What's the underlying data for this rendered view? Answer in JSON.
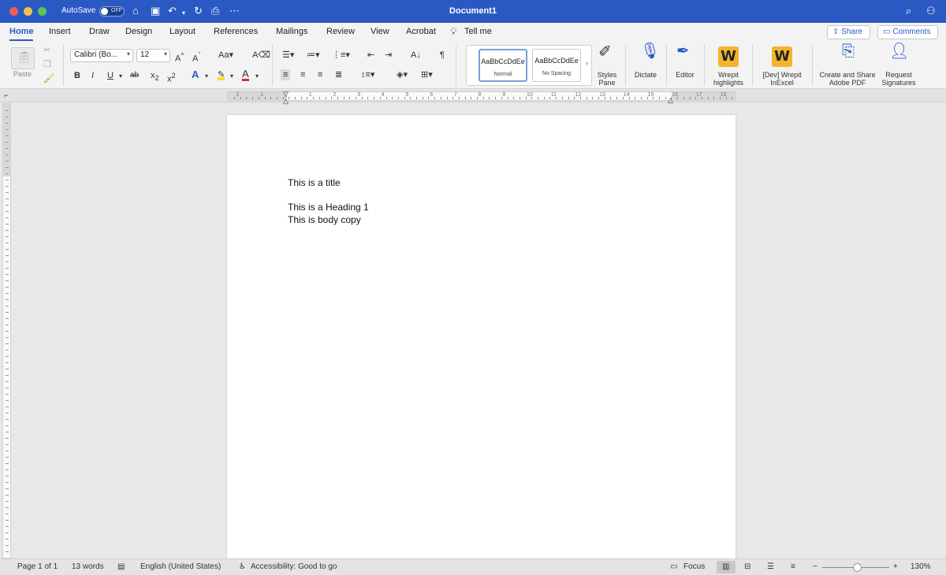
{
  "titlebar": {
    "autosave_label": "AutoSave",
    "autosave_state": "OFF",
    "document_title": "Document1"
  },
  "tabs": [
    {
      "label": "Home",
      "active": true
    },
    {
      "label": "Insert"
    },
    {
      "label": "Draw"
    },
    {
      "label": "Design"
    },
    {
      "label": "Layout"
    },
    {
      "label": "References"
    },
    {
      "label": "Mailings"
    },
    {
      "label": "Review"
    },
    {
      "label": "View"
    },
    {
      "label": "Acrobat"
    },
    {
      "label": "Tell me"
    }
  ],
  "actions": {
    "share": "Share",
    "comments": "Comments"
  },
  "ribbon": {
    "paste_label": "Paste",
    "font_name": "Calibri (Bo...",
    "font_size": "12",
    "styles": [
      {
        "sample": "AaBbCcDdEe",
        "name": "Normal",
        "selected": true
      },
      {
        "sample": "AaBbCcDdEe",
        "name": "No Spacing",
        "selected": false
      }
    ],
    "styles_pane": "Styles\nPane",
    "dictate": "Dictate",
    "editor": "Editor",
    "wrepit_highlights": "Wrepit\nhighlights",
    "dev_wrepit": "[Dev] Wrepit\nInExcel",
    "create_share_pdf": "Create and Share\nAdobe PDF",
    "request_signatures": "Request\nSignatures"
  },
  "ruler_numbers": [
    "2",
    "1",
    "1",
    "2",
    "3",
    "4",
    "5",
    "6",
    "7",
    "8",
    "9",
    "10",
    "11",
    "12",
    "13",
    "14",
    "15",
    "16",
    "17",
    "18"
  ],
  "document": {
    "lines": [
      "This is a title",
      "This is a Heading 1",
      "This is body copy"
    ]
  },
  "statusbar": {
    "page": "Page 1 of 1",
    "words": "13 words",
    "language": "English (United States)",
    "accessibility": "Accessibility: Good to go",
    "focus": "Focus",
    "zoom": "130%"
  },
  "colors": {
    "accent": "#2b59c3",
    "wrepit": "#f3b52a"
  }
}
